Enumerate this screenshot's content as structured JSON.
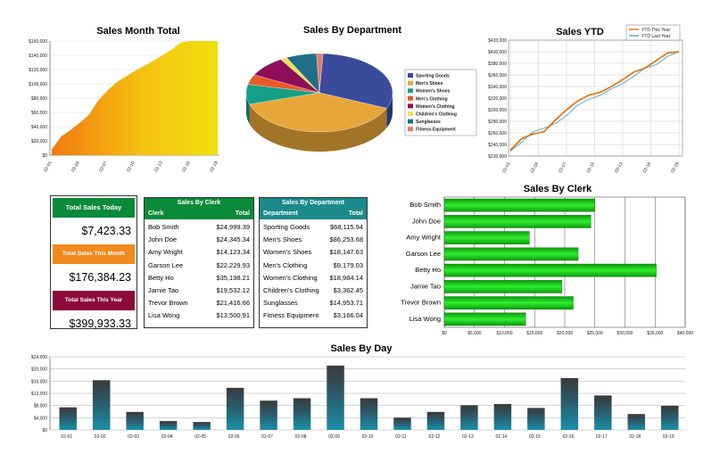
{
  "chart_data": [
    {
      "id": "sales_month_total",
      "type": "area",
      "title": "Sales Month Total",
      "x": [
        "02-01",
        "02-04",
        "02-07",
        "02-10",
        "02-13",
        "02-16",
        "02-19"
      ],
      "values": [
        8000,
        26000,
        35000,
        45000,
        56000,
        76000,
        90000,
        102000,
        110000,
        118000,
        125000,
        132000,
        140000,
        148000,
        158000,
        163000,
        170000,
        176000,
        176384
      ],
      "ylim": [
        0,
        160000
      ],
      "yticks": [
        "$0",
        "$20,000",
        "$40,000",
        "$60,000",
        "$80,000",
        "$100,000",
        "$120,000",
        "$140,000",
        "$160,000"
      ]
    },
    {
      "id": "sales_by_department_pie",
      "type": "pie",
      "title": "Sales By Department",
      "legend": [
        "Sporting Goods",
        "Men's Shoes",
        "Women's Shoes",
        "Men's Clothing",
        "Women's Clothing",
        "Children's Clothing",
        "Sunglasses",
        "Fitness Equipment"
      ],
      "values": [
        68115.94,
        86253.68,
        18147.63,
        9179.03,
        18984.14,
        3362.45,
        14953.71,
        3166.04
      ],
      "colors": [
        "#3a4b9c",
        "#e8a63a",
        "#13a085",
        "#e8592a",
        "#8e0e5a",
        "#f2df5a",
        "#206f86",
        "#e57a6a"
      ]
    },
    {
      "id": "sales_ytd",
      "type": "line",
      "title": "Sales YTD",
      "x": [
        "02-01",
        "02-04",
        "02-07",
        "02-10",
        "02-13",
        "02-16",
        "02-19"
      ],
      "series": [
        {
          "name": "YTD This Year",
          "values": [
            230000,
            250000,
            258000,
            262000,
            282000,
            300000,
            315000,
            325000,
            330000,
            340000,
            352000,
            365000,
            372000,
            385000,
            398000,
            400000
          ],
          "color": "#e07a1e"
        },
        {
          "name": "YTD Last Year",
          "values": [
            228000,
            244000,
            262000,
            268000,
            276000,
            290000,
            308000,
            318000,
            325000,
            336000,
            345000,
            358000,
            372000,
            378000,
            392000,
            400000
          ],
          "color": "#5aa9c9"
        }
      ],
      "ylim": [
        220000,
        420000
      ],
      "yticks": [
        "$220,000",
        "$240,000",
        "$260,000",
        "$280,000",
        "$300,000",
        "$320,000",
        "$340,000",
        "$360,000",
        "$380,000",
        "$400,000",
        "$420,000"
      ]
    },
    {
      "id": "sales_by_clerk_bar",
      "type": "bar",
      "title": "Sales By Clerk",
      "categories": [
        "Bob Smith",
        "John Doe",
        "Amy Wright",
        "Garson Lee",
        "Betty Ho",
        "Jamie Tao",
        "Trevor Brown",
        "Lisa Wong"
      ],
      "values": [
        24999.39,
        24345.34,
        14123.34,
        22229.93,
        35198.21,
        19532.12,
        21416.66,
        13500.91
      ],
      "xlim": [
        0,
        40000
      ],
      "xticks": [
        "$0",
        "$5,000",
        "$10,000",
        "$15,000",
        "$20,000",
        "$25,000",
        "$30,000",
        "$35,000",
        "$40,000"
      ]
    },
    {
      "id": "sales_by_day",
      "type": "bar",
      "title": "Sales By Day",
      "categories": [
        "02-01",
        "02-02",
        "02-03",
        "02-04",
        "02-05",
        "02-06",
        "02-07",
        "02-08",
        "02-09",
        "02-10",
        "02-11",
        "02-12",
        "02-13",
        "02-14",
        "02-15",
        "02-16",
        "02-17",
        "02-18",
        "02-19"
      ],
      "values": [
        7400,
        16300,
        5900,
        2900,
        2600,
        13800,
        9600,
        10400,
        21100,
        10400,
        4000,
        5900,
        8100,
        8500,
        7200,
        17000,
        11300,
        5200,
        7900
      ],
      "ylim": [
        0,
        24000
      ],
      "yticks": [
        "$0",
        "$4,000",
        "$8,000",
        "$12,000",
        "$16,000",
        "$20,000",
        "$24,000"
      ]
    }
  ],
  "kpi": {
    "today_label": "Total Sales Today",
    "today_value": "$7,423.33",
    "month_label": "Total Sales This Month",
    "month_value": "$176,384.23",
    "year_label": "Total Sales This Year",
    "year_value": "$399,933.33"
  },
  "clerk_table": {
    "title": "Sales By Clerk",
    "col1": "Clerk",
    "col2": "Total",
    "rows": [
      [
        "Bob Smith",
        "$24,999.39"
      ],
      [
        "John Doe",
        "$24,345.34"
      ],
      [
        "Amy Wright",
        "$14,123.34"
      ],
      [
        "Garson Lee",
        "$22,229.93"
      ],
      [
        "Betty Ho",
        "$35,198.21"
      ],
      [
        "Jamie Tao",
        "$19,532.12"
      ],
      [
        "Trevor Brown",
        "$21,416.66"
      ],
      [
        "Lisa Wong",
        "$13,500.91"
      ]
    ]
  },
  "dept_table": {
    "title": "Sales By Department",
    "col1": "Department",
    "col2": "Total",
    "rows": [
      [
        "Sporting Goods",
        "$68,115.94"
      ],
      [
        "Men's Shoes",
        "$86,253.68"
      ],
      [
        "Women's Shoes",
        "$18,147.63"
      ],
      [
        "Men's Clothing",
        "$9,179.03"
      ],
      [
        "Women's Clothing",
        "$18,984.14"
      ],
      [
        "Children's Clothing",
        "$3,362.45"
      ],
      [
        "Sunglasses",
        "$14,953.71"
      ],
      [
        "Fitness Equipment",
        "$3,166.04"
      ]
    ]
  },
  "colors": {
    "green": "#0a8a3a",
    "orange": "#f08a1e",
    "maroon": "#8a0a3a",
    "teal": "#1a8a8a",
    "clerk_bar": "#18d018",
    "day_bar_top": "#3a3a3a",
    "day_bar_bottom": "#1a8aa0"
  }
}
